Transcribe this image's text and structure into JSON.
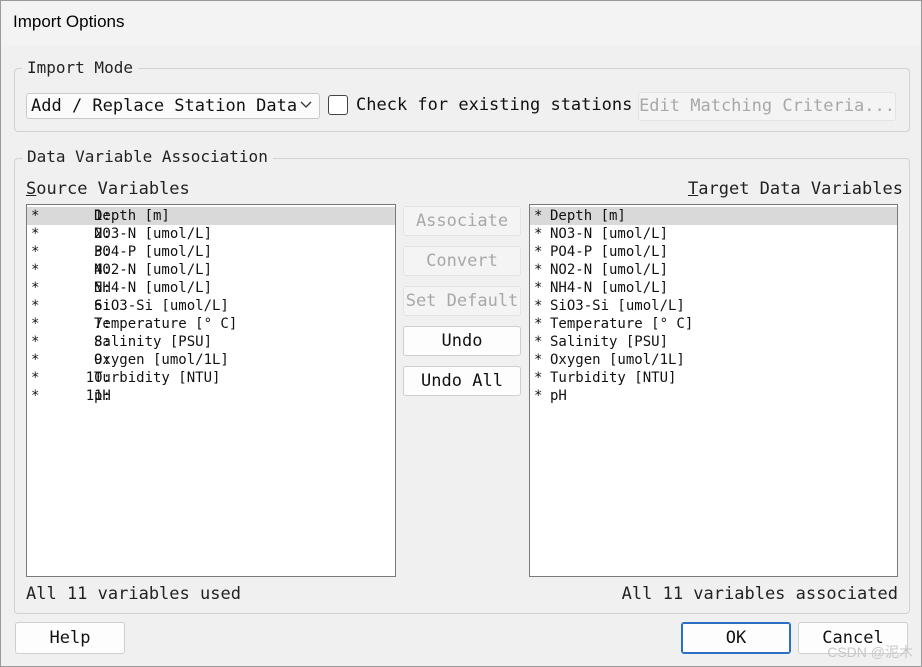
{
  "window": {
    "title": "Import Options"
  },
  "import_mode": {
    "legend": "Import Mode",
    "mode_select": "Add / Replace Station Data",
    "check_existing_label": "Check for existing stations",
    "check_existing_checked": false,
    "edit_matching_label": "Edit Matching Criteria..."
  },
  "association": {
    "legend": "Data Variable Association",
    "source_label_first": "S",
    "source_label_rest": "ource Variables",
    "target_label_first": "T",
    "target_label_rest": "arget Data Variables",
    "source_variables": [
      {
        "marker": "*",
        "num": "1:",
        "name": "Depth [m]"
      },
      {
        "marker": "*",
        "num": "2:",
        "name": "NO3-N [umol/L]"
      },
      {
        "marker": "*",
        "num": "3:",
        "name": "PO4-P [umol/L]"
      },
      {
        "marker": "*",
        "num": "4:",
        "name": "NO2-N [umol/L]"
      },
      {
        "marker": "*",
        "num": "5:",
        "name": "NH4-N [umol/L]"
      },
      {
        "marker": "*",
        "num": "6:",
        "name": "SiO3-Si [umol/L]"
      },
      {
        "marker": "*",
        "num": "7:",
        "name": "Temperature [° C]"
      },
      {
        "marker": "*",
        "num": "8:",
        "name": "Salinity [PSU]"
      },
      {
        "marker": "*",
        "num": "9:",
        "name": "Oxygen [umol/1L]"
      },
      {
        "marker": "*",
        "num": "10:",
        "name": "Turbidity [NTU]"
      },
      {
        "marker": "*",
        "num": "11:",
        "name": "pH"
      }
    ],
    "target_variables": [
      {
        "marker": "*",
        "name": "Depth [m]"
      },
      {
        "marker": "*",
        "name": "NO3-N [umol/L]"
      },
      {
        "marker": "*",
        "name": "PO4-P [umol/L]"
      },
      {
        "marker": "*",
        "name": "NO2-N [umol/L]"
      },
      {
        "marker": "*",
        "name": "NH4-N [umol/L]"
      },
      {
        "marker": "*",
        "name": "SiO3-Si [umol/L]"
      },
      {
        "marker": "*",
        "name": "Temperature [° C]"
      },
      {
        "marker": "*",
        "name": "Salinity [PSU]"
      },
      {
        "marker": "*",
        "name": "Oxygen [umol/1L]"
      },
      {
        "marker": "*",
        "name": "Turbidity [NTU]"
      },
      {
        "marker": "*",
        "name": "pH"
      }
    ],
    "buttons": {
      "associate": "Associate",
      "convert": "Convert",
      "set_default": "Set Default",
      "undo": "Undo",
      "undo_all": "Undo All"
    },
    "source_status": "All 11 variables used",
    "target_status": "All 11 variables associated"
  },
  "footer": {
    "help": "Help",
    "ok": "OK",
    "cancel": "Cancel"
  },
  "watermark": "CSDN @泥木"
}
